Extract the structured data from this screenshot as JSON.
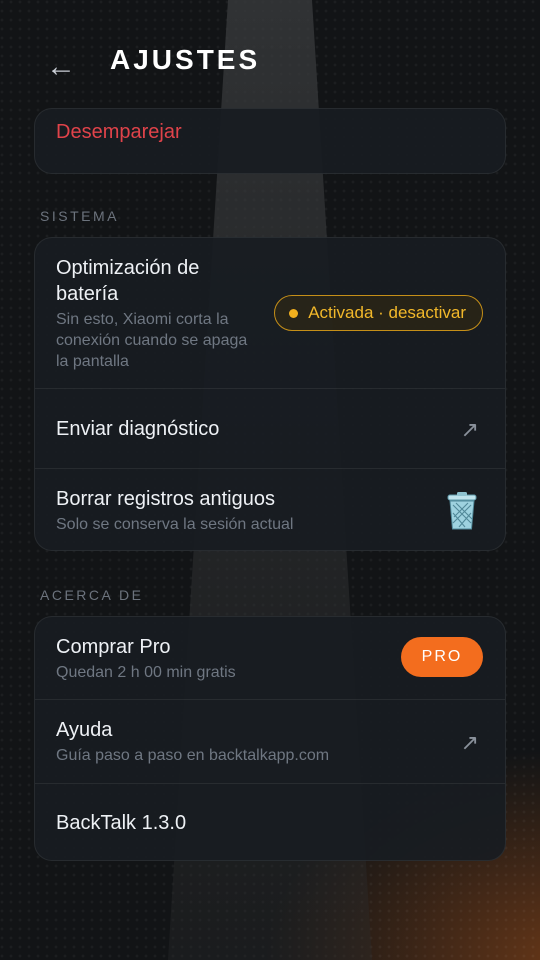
{
  "header": {
    "title": "AJUSTES",
    "back_icon": "arrow-left-icon"
  },
  "top_card": {
    "unpair_label": "Desemparejar"
  },
  "sistema": {
    "label": "SISTEMA",
    "battery": {
      "title": "Optimización de batería",
      "subtitle": "Sin esto, Xiaomi corta la conexión cuando se apaga la pantalla",
      "status": "Activada · desactivar"
    },
    "diagnostic": {
      "title": "Enviar diagnóstico"
    },
    "logs": {
      "title": "Borrar registros antiguos",
      "subtitle": "Solo se conserva la sesión actual"
    }
  },
  "acerca": {
    "label": "ACERCA DE",
    "pro": {
      "title": "Comprar Pro",
      "subtitle": "Quedan 2 h 00 min gratis",
      "badge": "PRO"
    },
    "help": {
      "title": "Ayuda",
      "subtitle": "Guía paso a paso en backtalkapp.com"
    },
    "version": {
      "title": "BackTalk 1.3.0"
    }
  },
  "colors": {
    "accent_orange": "#f36d1e",
    "warning_amber": "#f2b82a",
    "danger_red": "#e0434a",
    "background": "#121416"
  }
}
